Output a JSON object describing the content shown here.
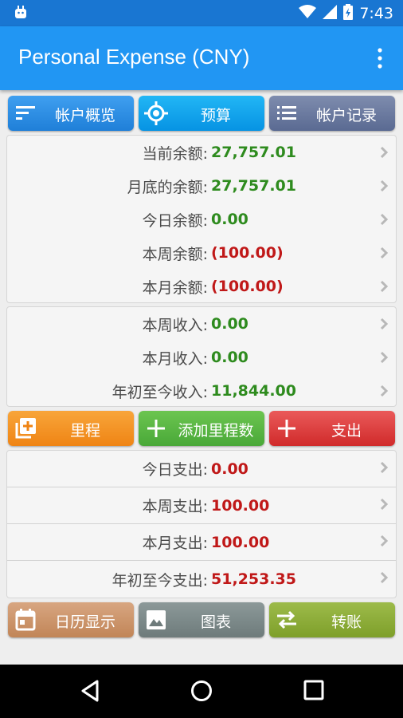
{
  "status": {
    "time": "7:43"
  },
  "appbar": {
    "title": "Personal Expense (CNY)"
  },
  "nav_buttons": {
    "overview": "帐户概览",
    "budget": "预算",
    "records": "帐户记录"
  },
  "balance": [
    {
      "label": "当前余额:",
      "value": "27,757.01"
    },
    {
      "label": "月底的余额:",
      "value": "27,757.01"
    },
    {
      "label": "今日余额:",
      "value": "0.00"
    },
    {
      "label": "本周余额:",
      "value": "(100.00)"
    },
    {
      "label": "本月余额:",
      "value": "(100.00)"
    }
  ],
  "income": [
    {
      "label": "本周收入:",
      "value": "0.00"
    },
    {
      "label": "本月收入:",
      "value": "0.00"
    },
    {
      "label": "年初至今收入:",
      "value": "11,844.00"
    }
  ],
  "action_buttons": {
    "mileage": "里程",
    "add_mileage": "添加里程数",
    "expense": "支出"
  },
  "expense": [
    {
      "label": "今日支出:",
      "value": "0.00"
    },
    {
      "label": "本周支出:",
      "value": "100.00"
    },
    {
      "label": "本月支出:",
      "value": "100.00"
    },
    {
      "label": "年初至今支出:",
      "value": "51,253.35"
    }
  ],
  "bottom_buttons": {
    "calendar": "日历显示",
    "chart": "图表",
    "transfer": "转账"
  },
  "colors": {
    "appbar": "#2196f3",
    "statusbar": "#1976d2",
    "positive": "#2e8b1e",
    "negative": "#c01818"
  }
}
